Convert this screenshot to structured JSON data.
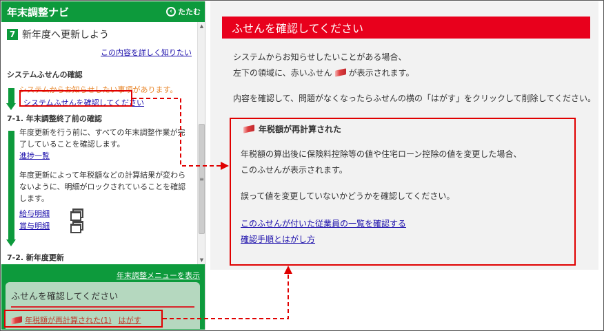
{
  "sidebar": {
    "title": "年末調整ナビ",
    "collapse_label": "たたむ",
    "step_number": "7",
    "step_title": "新年度へ更新しよう",
    "detail_link": "この内容を詳しく知りたい",
    "section1": {
      "title": "システムふせんの確認",
      "notice": "システムからお知らせしたい事項があります。",
      "link": "システムふせんを確認してください"
    },
    "section2": {
      "title": "7-1. 年末調整終了前の確認",
      "text1": "年度更新を行う前に、すべての年末調整作業が完了していることを確認します。",
      "link_progress": "進捗一覧",
      "text2": "年度更新によって年税額などの計算結果が変わらないように、明細がロックされていることを確認します。",
      "link_salary": "給与明細",
      "link_bonus": "賞与明細"
    },
    "section3": {
      "title": "7-2. 新年度更新"
    },
    "menu_link": "年末調整メニューを表示",
    "note_box": {
      "title": "ふせんを確認してください",
      "item_link": "年税額が再計算された(1)",
      "peel_link": "はがす"
    }
  },
  "main": {
    "banner": "ふせんを確認してください",
    "line1": "システムからお知らせしたいことがある場合、",
    "line2a": "左下の領域に、赤いふせん",
    "line2b": "が表示されます。",
    "line3": "内容を確認して、問題がなくなったらふせんの横の「はがす」をクリックして削除してください。",
    "card": {
      "title": "年税額が再計算された",
      "text1": "年税額の算出後に保険料控除等の値や住宅ローン控除の値を変更した場合、",
      "text2": "このふせんが表示されます。",
      "text3": "誤って値を変更していないかどうかを確認してください。",
      "link1": "このふせんが付いた従業員の一覧を確認する",
      "link2": "確認手順とはがし方"
    }
  },
  "colors": {
    "brand_green": "#0d9a3c",
    "banner_red": "#e8001c",
    "highlight_red": "#e00000",
    "note_green": "#b5d8bf"
  }
}
